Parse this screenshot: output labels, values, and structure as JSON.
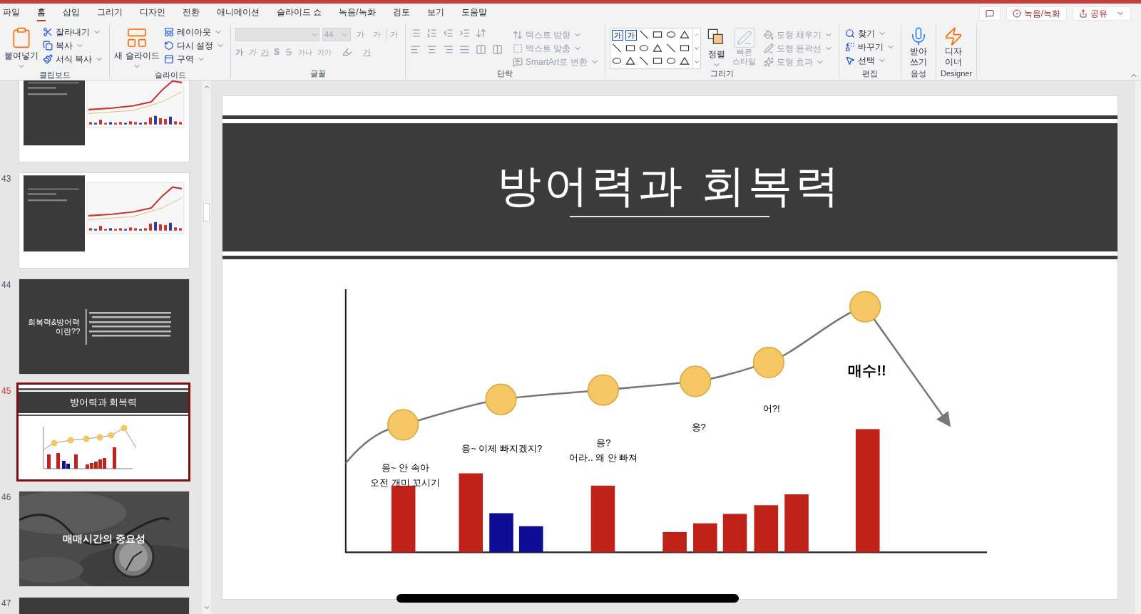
{
  "tabs": [
    {
      "label": "파일",
      "selected": false
    },
    {
      "label": "홈",
      "selected": true
    },
    {
      "label": "삽입",
      "selected": false
    },
    {
      "label": "그리기",
      "selected": false
    },
    {
      "label": "디자인",
      "selected": false
    },
    {
      "label": "전환",
      "selected": false
    },
    {
      "label": "애니메이션",
      "selected": false
    },
    {
      "label": "슬라이드 쇼",
      "selected": false
    },
    {
      "label": "녹음/녹화",
      "selected": false
    },
    {
      "label": "검토",
      "selected": false
    },
    {
      "label": "보기",
      "selected": false
    },
    {
      "label": "도움말",
      "selected": false
    }
  ],
  "header_buttons": [
    {
      "kind": "comment"
    },
    {
      "kind": "record",
      "label": "녹음/녹화"
    },
    {
      "kind": "share",
      "label": "공유"
    }
  ],
  "ribbon": [
    {
      "kind": "clipboard",
      "label": "클립보드",
      "big": "붙여넣기",
      "items": [
        {
          "label": "잘라내기",
          "disabled": false
        },
        {
          "label": "복사",
          "disabled": false
        },
        {
          "label": "서식 복사",
          "disabled": false
        }
      ]
    },
    {
      "kind": "slides",
      "label": "슬라이드",
      "big": "새 슬라이드",
      "items": [
        {
          "label": "레이아웃",
          "disabled": false
        },
        {
          "label": "다시 설정",
          "disabled": false
        },
        {
          "label": "구역",
          "disabled": false
        }
      ]
    },
    {
      "kind": "font",
      "label": "글꼴",
      "disabled": true,
      "font_size": "44",
      "size_buttons": [
        "가",
        "가"
      ],
      "clear": "가",
      "format_buttons": [
        "가",
        "가",
        "가",
        "S"
      ],
      "spacing": "가나",
      "case": "가가",
      "color_button": "가"
    },
    {
      "kind": "paragraph",
      "label": "단락",
      "items": [
        {
          "label": "텍스트 방향",
          "disabled": true
        },
        {
          "label": "텍스트 맞춤",
          "disabled": true
        },
        {
          "label": "SmartArt로 변환",
          "disabled": true
        }
      ]
    },
    {
      "kind": "drawing",
      "label": "그리기",
      "gallery_glyphs": [
        "가",
        "가"
      ],
      "arrange": "정렬",
      "quick_styles": {
        "label": "빠른 스타일",
        "disabled": true
      },
      "items": [
        {
          "label": "도형 채우기",
          "disabled": true
        },
        {
          "label": "도형 윤곽선",
          "disabled": true
        },
        {
          "label": "도형 효과",
          "disabled": true
        }
      ]
    },
    {
      "kind": "editing",
      "label": "편집",
      "items": [
        {
          "label": "찾기",
          "disabled": false
        },
        {
          "label": "바꾸기",
          "disabled": false
        },
        {
          "label": "선택",
          "disabled": false
        }
      ]
    },
    {
      "kind": "voice",
      "label": "음성",
      "big": "받아 쓰기"
    },
    {
      "kind": "designer",
      "label": "Designer",
      "big": "디자 이너"
    }
  ],
  "slides": [
    {
      "kind": "chart",
      "selected": false
    },
    {
      "number": "43",
      "kind": "chart",
      "selected": false
    },
    {
      "number": "44",
      "kind": "text",
      "title_lines": [
        "회복력&방어력",
        "이란??"
      ],
      "selected": false
    },
    {
      "number": "45",
      "kind": "chart_title",
      "title": "방어력과 회복력",
      "selected": true
    },
    {
      "number": "46",
      "title": "매매시간의 중요성",
      "selected": false
    },
    {
      "number": "47",
      "kind": "dark",
      "selected": false
    }
  ],
  "slide": {
    "title": "방어력과 회복력",
    "annotations": [
      {
        "lines": [
          "응~ 안 속아",
          "오전 개미 꼬시기"
        ],
        "emphasis": false
      },
      {
        "lines": [
          "응~ 이제 빠지겠지?"
        ],
        "emphasis": false
      },
      {
        "lines": [
          "응?",
          "어라.. 왜 안 빠져"
        ],
        "emphasis": false
      },
      {
        "lines": [
          "응?"
        ],
        "emphasis": false
      },
      {
        "lines": [
          "어?!"
        ],
        "emphasis": false
      },
      {
        "lines": [
          "매수!!"
        ],
        "emphasis": true
      }
    ]
  }
}
